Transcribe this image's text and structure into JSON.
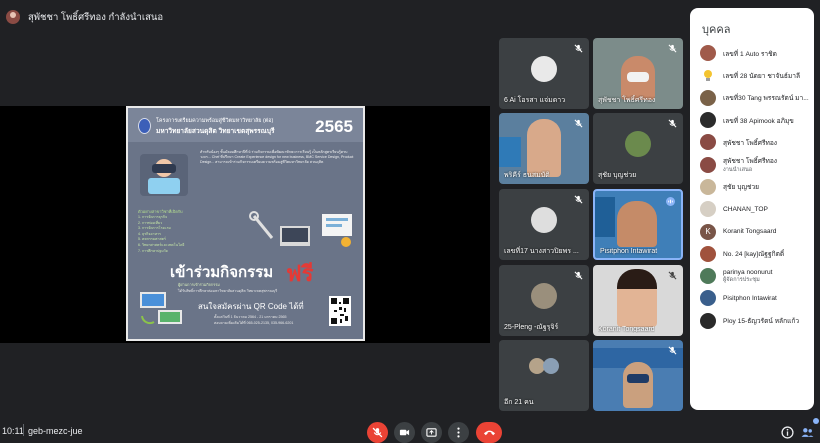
{
  "presenter": {
    "name": "สุพัชชา โพธิ์ศรีทอง กำลังนำเสนอ"
  },
  "slide": {
    "title_line1": "โครงการเตรียมความพร้อมสู่ชีวิตมหาวิทยาลัย (ต่อ)",
    "title_line2": "มหาวิทยาลัยสวนดุสิต วิทยาเขตสุพรรณบุรี",
    "year": "2565",
    "desc": "สำหรับน้องๆ ชั้นมัธยมศึกษาปีที่ 6 ร่วมกิจกรรมเพื่อพัฒนาทักษะการเรียนรู้ เป็นหลักสูตรเรียนรู้ครบวงจร... Chef ที่ปรึกษา Create Experience design for new business, BMC Service Design, Product Design... สามารถเข้าร่วมกิจกรรมเตรียมความพร้อมสู่ชีวิตมหาวิทยาลัย สวนดุสิต",
    "list_title": "ตัวอย่างสาขาวิชาที่เปิดรับ",
    "list": [
      "1. การจัดการธุรกิจ",
      "2. การท่องเที่ยว",
      "3. การจัดการโรงแรม",
      "4. ธุรกิจอาหาร",
      "5. คหกรรมศาสตร์",
      "6. วิทยาศาสตร์และเทคโนโลยี",
      "7. การศึกษาปฐมวัย"
    ],
    "join": "เข้าร่วมกิจกรรม",
    "free": "ฟรี",
    "sub1": "ผู้ผ่านการเข้าร่วมกิจกรรม",
    "sub2": "ได้รับสิทธิ์การศึกษาต่อมหาวิทยาลัยสวนดุสิต วิทยาเขตสุพรรณบุรี",
    "qr_text": "สนใจสมัครผ่าน QR Code ได้ที่",
    "date": "ตั้งแต่วันที่ 1 ธันวาคม 2564 - 21 มกราคม 2565",
    "contact": "สอบถามเพิ่มเติมได้ที่ 065-025-2135, 035-966-6201"
  },
  "tiles": [
    {
      "name": "6 Ai โอรสา แจ่มดาว"
    },
    {
      "name": "สุพัชชา โพธิ์ศรีทอง"
    },
    {
      "name": "พริคีร์ ธนสมบัติ"
    },
    {
      "name": "สุชัย บุญช่วย"
    },
    {
      "name": "เลขที่17 นางสาวปิยพร ..."
    },
    {
      "name": "Pisitphon Intawirat"
    },
    {
      "name": "25-Pleng -ณัฐรุจิร์"
    },
    {
      "name": "Koranit Tongsaard"
    },
    {
      "name": "อีก 21 คน"
    },
    {
      "name": ""
    }
  ],
  "panel": {
    "title": "บุคคล",
    "people": [
      {
        "name": "เลขที่ 1 Auto ราชิด",
        "sub": ""
      },
      {
        "name": "เลขที่ 28 นัดยา ชาจันธ์มาลี",
        "sub": ""
      },
      {
        "name": "เลขที่30 Tang พรรณรัตน์ มา...",
        "sub": ""
      },
      {
        "name": "เลขที่ 38 Apimook อภิมุข",
        "sub": ""
      },
      {
        "name": "สุพัชชา โพธิ์ศรีทอง",
        "sub": ""
      },
      {
        "name": "สุพัชชา โพธิ์ศรีทอง",
        "sub": "งานนำเสนอ"
      },
      {
        "name": "สุชัย บุญช่วย",
        "sub": ""
      },
      {
        "name": "CHANAN_TOP",
        "sub": ""
      },
      {
        "name": "Koranit Tongsaard",
        "sub": ""
      },
      {
        "name": "No. 24 [kay]ณัฐฐกิตติ์",
        "sub": ""
      },
      {
        "name": "parinya noonurut",
        "sub": "ผู้จัดการประชุม"
      },
      {
        "name": "Pisitphon Intawirat",
        "sub": ""
      },
      {
        "name": "Ploy 15-ธัญวรัตน์ หลักแก้ว",
        "sub": ""
      }
    ]
  },
  "bottom": {
    "time": "10:11",
    "meeting_code": "geb-mezc-jue"
  },
  "colors": {
    "background": "#202124",
    "tile": "#3c4043",
    "end_call": "#ea4335",
    "accent": "#8ab4f8"
  }
}
